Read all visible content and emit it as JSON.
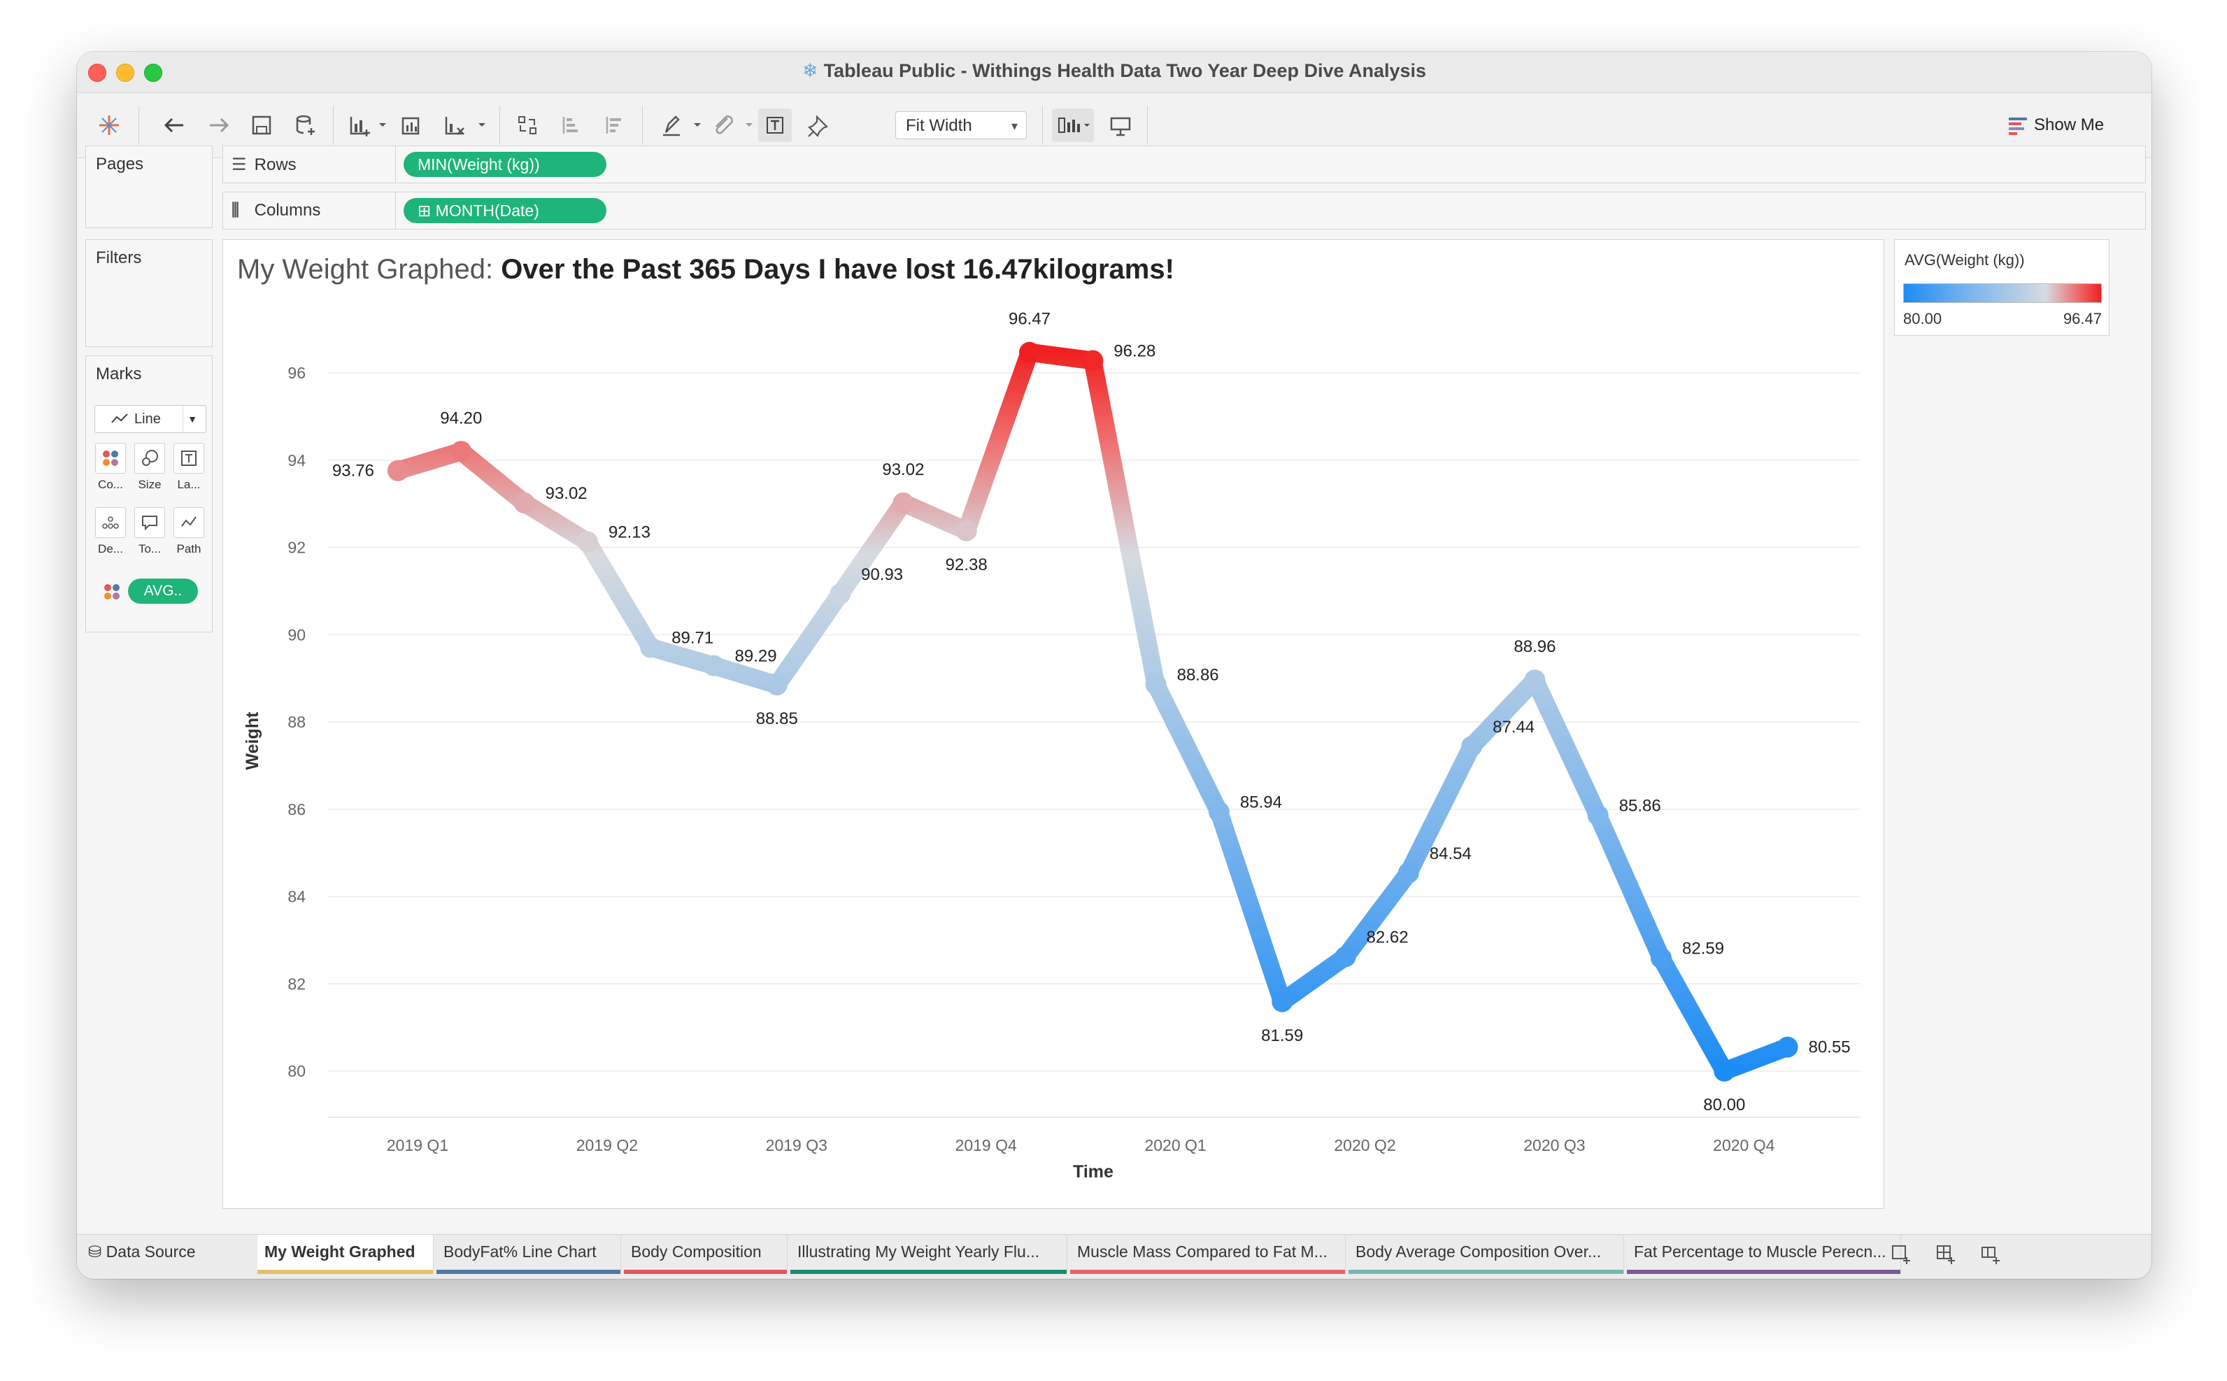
{
  "window": {
    "title": "Tableau Public - Withings Health Data Two Year Deep Dive Analysis"
  },
  "toolbar": {
    "fit_select": "Fit Width",
    "show_me": "Show Me"
  },
  "shelves": {
    "pages": "Pages",
    "filters": "Filters",
    "rows_label": "Rows",
    "rows_pill": "MIN(Weight (kg))",
    "columns_label": "Columns",
    "columns_pill": "⊞ MONTH(Date)"
  },
  "marks": {
    "title": "Marks",
    "type": "Line",
    "cards": [
      "Co...",
      "Size",
      "La...",
      "De...",
      "To...",
      "Path"
    ],
    "pill": "AVG.."
  },
  "viz": {
    "title_light": "My Weight Graphed: ",
    "title_bold": "Over the Past 365 Days I have lost 16.47kilograms!"
  },
  "legend": {
    "title": "AVG(Weight (kg))",
    "min": "80.00",
    "max": "96.47"
  },
  "chart_data": {
    "type": "line",
    "title": "My Weight Graphed: Over the Past 365 Days I have lost 16.47kilograms!",
    "xlabel": "Time",
    "ylabel": "Weight",
    "x_ticks": [
      "2019 Q1",
      "2019 Q2",
      "2019 Q3",
      "2019 Q4",
      "2020 Q1",
      "2020 Q2",
      "2020 Q3",
      "2020 Q4"
    ],
    "y_ticks": [
      80,
      82,
      84,
      86,
      88,
      90,
      92,
      94,
      96
    ],
    "ylim": [
      79,
      97
    ],
    "months": [
      "2019-01",
      "2019-02",
      "2019-03",
      "2019-04",
      "2019-05",
      "2019-06",
      "2019-07",
      "2019-08",
      "2019-09",
      "2019-10",
      "2019-11",
      "2019-12",
      "2020-01",
      "2020-02",
      "2020-03",
      "2020-04",
      "2020-05",
      "2020-06",
      "2020-07",
      "2020-08",
      "2020-09",
      "2020-10",
      "2020-11",
      "2020-12"
    ],
    "values": [
      93.76,
      94.2,
      93.02,
      92.13,
      89.71,
      89.29,
      88.85,
      90.93,
      93.02,
      92.38,
      96.47,
      96.28,
      88.86,
      85.94,
      81.59,
      82.62,
      84.54,
      87.44,
      88.96,
      85.86,
      82.59,
      80.0,
      80.55
    ],
    "color_scale": {
      "field": "AVG(Weight (kg))",
      "min": 80.0,
      "max": 96.47,
      "low_color": "#1e8cf5",
      "mid_color": "#d6dbe0",
      "high_color": "#f12020"
    },
    "grid": "horizontal"
  },
  "tabs": {
    "data_source": "Data Source",
    "sheets": [
      {
        "label": "My Weight Graphed",
        "color": "#e5c06a"
      },
      {
        "label": "BodyFat% Line Chart",
        "color": "#4e79a7"
      },
      {
        "label": "Body Composition",
        "color": "#e15759"
      },
      {
        "label": "Illustrating My Weight Yearly Flu...",
        "color": "#1b8c6e"
      },
      {
        "label": "Muscle Mass Compared to Fat M...",
        "color": "#e8636b"
      },
      {
        "label": "Body Average Composition Over...",
        "color": "#76b7b2"
      },
      {
        "label": "Fat Percentage to Muscle Perecn...",
        "color": "#7b5a96"
      }
    ]
  }
}
